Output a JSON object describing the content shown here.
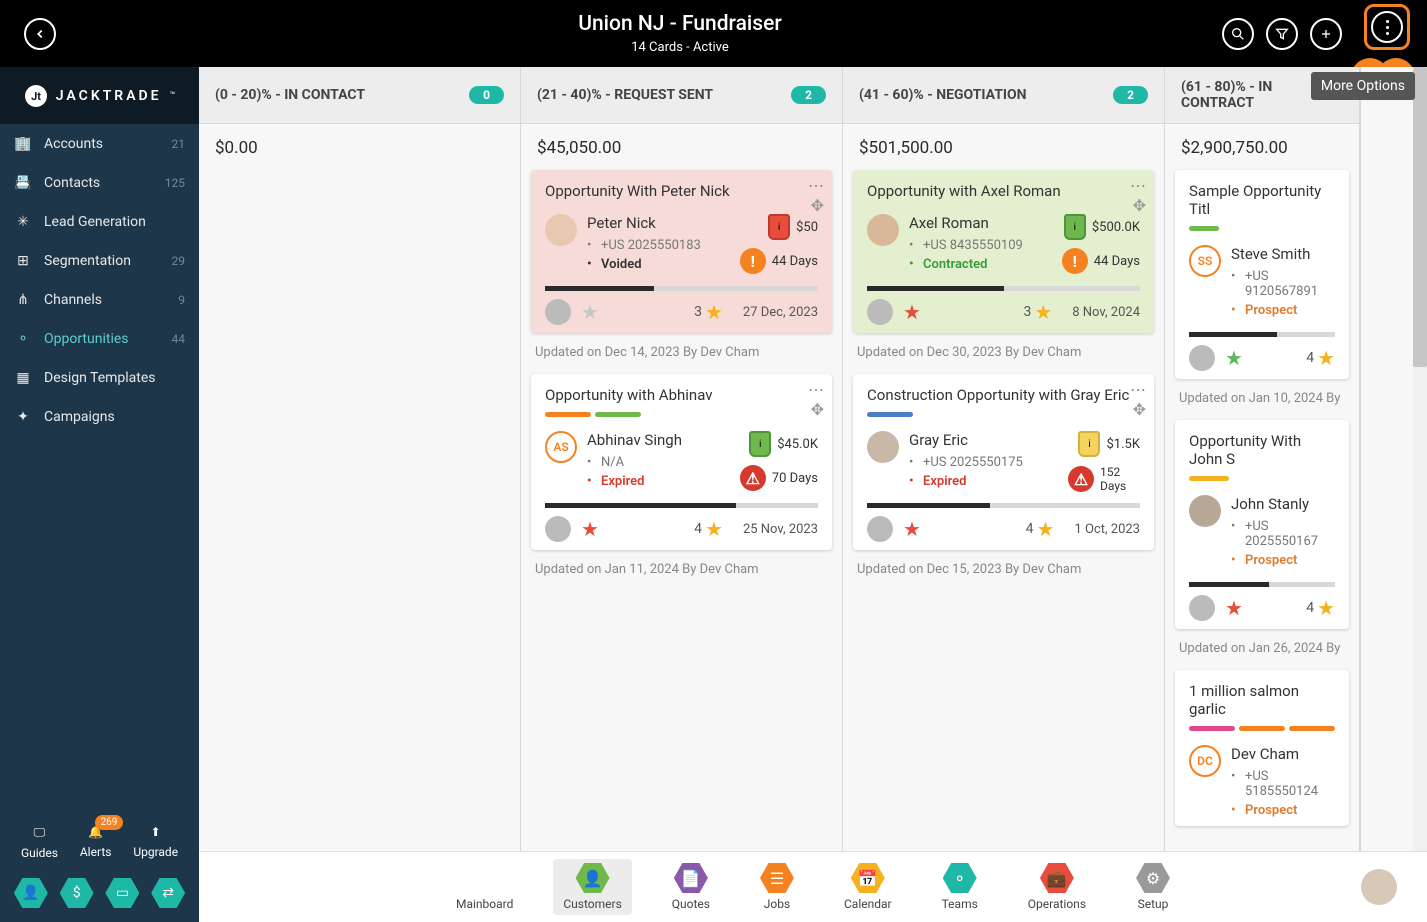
{
  "header": {
    "title": "Union NJ - Fundraiser",
    "subtitle": "14 Cards - Active",
    "tooltip": "More Options"
  },
  "sidebar": {
    "brand": "JACKTRADE",
    "items": [
      {
        "label": "Accounts",
        "count": "21"
      },
      {
        "label": "Contacts",
        "count": "125"
      },
      {
        "label": "Lead Generation",
        "count": ""
      },
      {
        "label": "Segmentation",
        "count": "29"
      },
      {
        "label": "Channels",
        "count": "9"
      },
      {
        "label": "Opportunities",
        "count": "44"
      },
      {
        "label": "Design Templates",
        "count": ""
      },
      {
        "label": "Campaigns",
        "count": ""
      }
    ],
    "bottom": {
      "guides": "Guides",
      "alerts": "Alerts",
      "alerts_badge": "269",
      "upgrade": "Upgrade"
    }
  },
  "columns": [
    {
      "title": "(0 - 20)% - IN CONTACT",
      "count": "0",
      "total": "$0.00"
    },
    {
      "title": "(21 - 40)% - REQUEST SENT",
      "count": "2",
      "total": "$45,050.00"
    },
    {
      "title": "(41 - 60)% - NEGOTIATION",
      "count": "2",
      "total": "$501,500.00"
    },
    {
      "title": "(61 - 80)% - IN CONTRACT",
      "count": "",
      "total": "$2,900,750.00"
    }
  ],
  "cards": {
    "c1": {
      "title": "Opportunity With Peter Nick",
      "name": "Peter Nick",
      "phone": "+US 2025550183",
      "status": "Voided",
      "amount": "$50",
      "days": "44 Days",
      "rating": "3",
      "date": "27 Dec, 2023",
      "updated": "Updated on Dec 14, 2023 By Dev Cham"
    },
    "c2": {
      "title": "Opportunity with Abhinav",
      "initials": "AS",
      "name": "Abhinav Singh",
      "phone": "N/A",
      "status": "Expired",
      "amount": "$45.0K",
      "days": "70 Days",
      "rating": "4",
      "date": "25 Nov, 2023",
      "updated": "Updated on Jan 11, 2024 By Dev Cham"
    },
    "c3": {
      "title": "Opportunity with Axel Roman",
      "name": "Axel Roman",
      "phone": "+US 8435550109",
      "status": "Contracted",
      "amount": "$500.0K",
      "days": "44 Days",
      "rating": "3",
      "date": "8 Nov, 2024",
      "updated": "Updated on Dec 30, 2023 By Dev Cham"
    },
    "c4": {
      "title": "Construction Opportunity with Gray Eric",
      "name": "Gray Eric",
      "phone": "+US 2025550175",
      "status": "Expired",
      "amount": "$1.5K",
      "days": "152 Days",
      "rating": "4",
      "date": "1 Oct, 2023",
      "updated": "Updated on Dec 15, 2023 By Dev Cham"
    },
    "c5": {
      "title": "Sample Opportunity Titl",
      "initials": "SS",
      "name": "Steve Smith",
      "phone": "+US 9120567891",
      "status": "Prospect",
      "rating": "4",
      "updated": "Updated on Jan 10, 2024 By"
    },
    "c6": {
      "title": "Opportunity With John S",
      "name": "John Stanly",
      "phone": "+US 2025550167",
      "status": "Prospect",
      "rating": "4",
      "updated": "Updated on Jan 26, 2024 By"
    },
    "c7": {
      "title": "1 million salmon garlic",
      "initials": "DC",
      "name": "Dev Cham",
      "phone": "+US 5185550124",
      "status": "Prospect"
    }
  },
  "bottomnav": [
    {
      "label": "Mainboard",
      "color": "#f5b120"
    },
    {
      "label": "Customers",
      "color": "#6fb84e"
    },
    {
      "label": "Quotes",
      "color": "#8a5aa8"
    },
    {
      "label": "Jobs",
      "color": "#f58220"
    },
    {
      "label": "Calendar",
      "color": "#f5b120"
    },
    {
      "label": "Teams",
      "color": "#1fb8a6"
    },
    {
      "label": "Operations",
      "color": "#e74c3c"
    },
    {
      "label": "Setup",
      "color": "#999"
    }
  ]
}
